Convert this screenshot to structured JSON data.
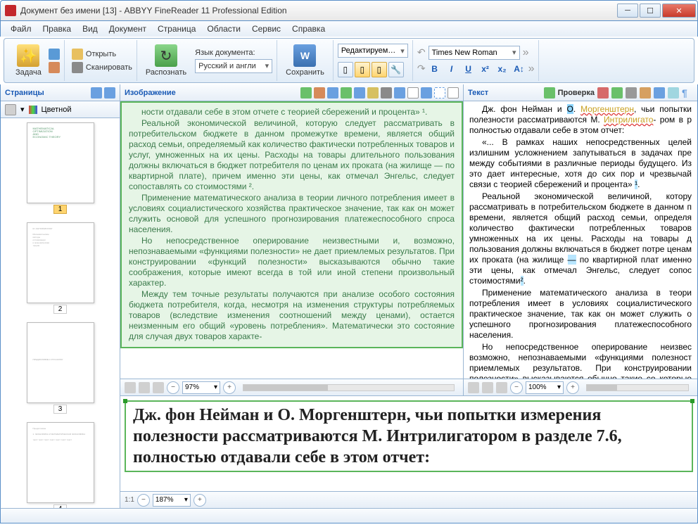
{
  "title": "Документ без имени [13] - ABBYY FineReader 11 Professional Edition",
  "menu": [
    "Файл",
    "Правка",
    "Вид",
    "Документ",
    "Страница",
    "Области",
    "Сервис",
    "Справка"
  ],
  "toolbar": {
    "task": "Задача",
    "open": "Открыть",
    "scan": "Сканировать",
    "recognize": "Распознать",
    "lang_label": "Язык документа:",
    "lang_value": "Русский и англи",
    "save": "Сохранить",
    "edit_mode": "Редактируем…",
    "font": "Times New Roman"
  },
  "panels": {
    "pages": "Страницы",
    "pages_view": "Цветной",
    "image": "Изображение",
    "text": "Текст",
    "check": "Проверка"
  },
  "pages": [
    "1",
    "2",
    "3",
    "4"
  ],
  "zoom": {
    "image": "97%",
    "text": "100%",
    "bottom": "187%"
  },
  "image_text": {
    "p0": "ности отдавали себе в этом отчете с теорией сбережений и процента» ¹.",
    "p1": "Реальной экономической величиной, которую следует рассматривать в потребительском бюджете в данном промежутке времени, является общий расход семьи, определяемый как количество фактически потребленных товаров и услуг, умноженных на их цены. Расходы на товары длительного пользования должны включаться в бюджет потребителя по ценам их проката (на жилище — по квартирной плате), причем именно эти цены, как отмечал Энгельс, следует сопоставлять со стоимостями ².",
    "p2": "Применение математического анализа в теории личного потребления имеет в условиях социалистического хозяйства практическое значение, так как он может служить основой для успешного прогнозирования платежеспособного спроса населения.",
    "p3": "Но непосредственное оперирование неизвестными и, возможно, непознаваемыми «функциями полезности» не дает приемлемых результатов. При конструировании «функций полезности» высказываются обычно такие соображения, которые имеют всегда в той или иной степени произвольный характер.",
    "p4": "Между тем точные результаты получаются при анализе особого состояния бюджета потребителя, когда, несмотря на изменения структуры потребляемых товаров (вследствие изменения соотношений между ценами), остается неизменным его общий «уровень потребления». Математически это состояние для случая двух товаров характе-"
  },
  "text_text": {
    "p1_a": "Дж. фон Нейман и ",
    "p1_hl": "О",
    "p1_b": ". ",
    "p1_sq": "Моргенштерн",
    "p1_c": ", чьи попытки полезности рассматриваются М. ",
    "p1_sq2": "Интрилигато",
    "p1_d": "- ром в р полностью отдавали себе в этом отчет:",
    "p2": "«... В рамках наших непосредственных целей излишним усложнением запутываться в задачах пре между событиями в различные периоды будущего. Из это дает интересные, хотя до сих пор и чрезвычай связи с теорией сбережений и процента» ",
    "p3": "Реальной экономической величиной, котору рассматривать в потребительском бюджете в данном п времени, является общий расход семьи, определя количество фактически потребленных товаров умноженных на их цены. Расходы на товары д пользования должны включаться в бюджет потре ценам их проката (на жилище ",
    "p3_dash": "—",
    "p3b": " по квартирной плат именно эти цены, как отмечал Энгельс, следует сопос стоимостями",
    "p4": "Применение математического анализа в теори потребления имеет в условиях социалистического практическое значение, так как он может служить о успешного прогнозирования платежеспособного населения.",
    "p5": "Но непосредственное оперирование неизвес возможно, непознаваемыми «функциями полезност приемлемых результатов. При конструировании полезности» высказываются обычно такие со которые имеют всегда в той или иной степени про"
  },
  "zoom_text": "Дж. фон Нейман и О. Моргенштерн, чьи попытки измерения полезности рассматриваются М. Интрилигатором в разделе 7.6, полностью отдавали себе в этом отчет:"
}
